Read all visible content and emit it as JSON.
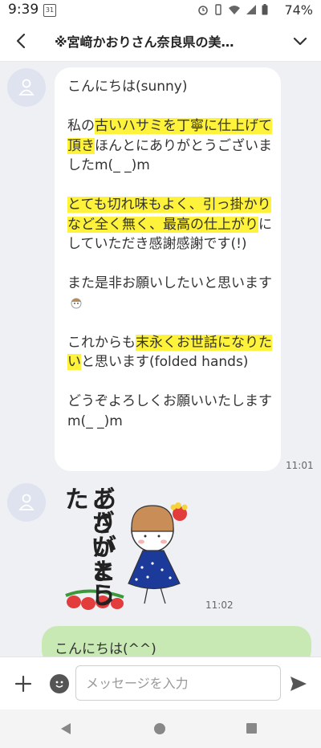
{
  "status_bar": {
    "time": "9:39",
    "calendar_day": "31",
    "battery": "74%"
  },
  "header": {
    "title": "※宮﨑かおりさん奈良県の美…"
  },
  "messages": {
    "incoming_1": {
      "p1": "こんにちは(sunny)",
      "p2_a": "私の",
      "p2_hl": "古いハサミを丁寧に仕上げて頂き",
      "p2_b": "ほんとにありがとうございましたm(_ _)m",
      "p3_hl": "とても切れ味もよく、引っ掛かりなど全く無く、最高の仕上がり",
      "p3_b": "にしていただき感謝感謝です(!)",
      "p4": "また是非お願いしたいと思います",
      "p5_a": "これからも",
      "p5_hl": "末永くお世話になりたい",
      "p5_b": "と思います(folded hands)",
      "p6": "どうぞよろしくお願いいたしますm(_ _)m",
      "time": "11:01"
    },
    "sticker": {
      "text_line1": "ありがとう",
      "text_line2": "ございました",
      "time": "11:02"
    },
    "outgoing_1": {
      "text": "こんにちは(^^)"
    }
  },
  "input": {
    "placeholder": "メッセージを入力"
  },
  "colors": {
    "highlight": "#fff23a",
    "outgoing_bubble": "#c8e9b3",
    "chat_bg": "#eef0f4"
  }
}
